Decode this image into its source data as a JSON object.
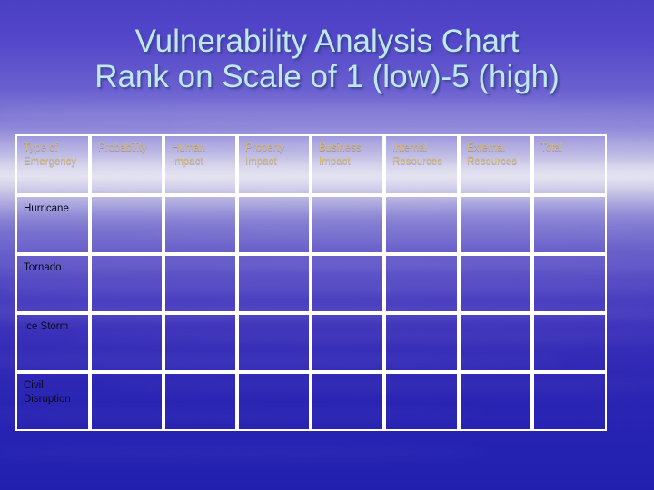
{
  "slide": {
    "title_line_1": "Vulnerability Analysis Chart",
    "title_line_2": "Rank on Scale of 1 (low)-5 (high)",
    "colors": {
      "title_text": "#bfe9f0",
      "header_text": "#d2b97a",
      "row_label_text": "#0a0a1e",
      "grid_line": "#ffffff",
      "background_top": "#4b3fc4",
      "background_mid_light": "#e4e2f0",
      "background_bottom": "#2120ae"
    }
  },
  "table": {
    "headers": [
      "Type of Emergency",
      "Probability",
      "Human Impact",
      "Property Impact",
      "Business Impact",
      "Internal Resources",
      "External Resources",
      "Total"
    ],
    "rows": [
      {
        "label": "Hurricane",
        "cells": [
          "",
          "",
          "",
          "",
          "",
          "",
          ""
        ]
      },
      {
        "label": "Tornado",
        "cells": [
          "",
          "",
          "",
          "",
          "",
          "",
          ""
        ]
      },
      {
        "label": "Ice Storm",
        "cells": [
          "",
          "",
          "",
          "",
          "",
          "",
          ""
        ]
      },
      {
        "label": "Civil Disruption",
        "cells": [
          "",
          "",
          "",
          "",
          "",
          "",
          ""
        ]
      }
    ]
  }
}
